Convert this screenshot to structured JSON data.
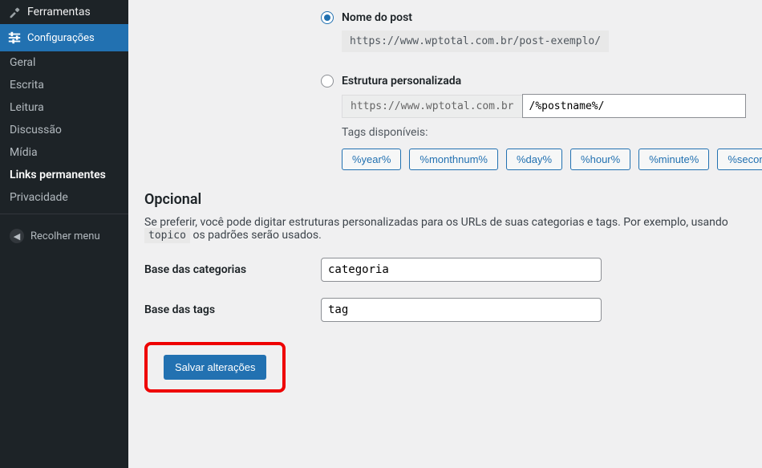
{
  "sidebar": {
    "tools_label": "Ferramentas",
    "settings_label": "Configurações",
    "items": [
      {
        "label": "Geral"
      },
      {
        "label": "Escrita"
      },
      {
        "label": "Leitura"
      },
      {
        "label": "Discussão"
      },
      {
        "label": "Mídia"
      },
      {
        "label": "Links permanentes"
      },
      {
        "label": "Privacidade"
      }
    ],
    "collapse_label": "Recolher menu"
  },
  "permalinks": {
    "post_name": {
      "label": "Nome do post",
      "url": "https://www.wptotal.com.br/post-exemplo/"
    },
    "custom": {
      "label": "Estrutura personalizada",
      "prefix": "https://www.wptotal.com.br",
      "value": "/%postname%/",
      "available_label": "Tags disponíveis:",
      "tags": [
        "%year%",
        "%monthnum%",
        "%day%",
        "%hour%",
        "%minute%",
        "%second%"
      ]
    }
  },
  "optional": {
    "heading": "Opcional",
    "desc_before": "Se preferir, você pode digitar estruturas personalizadas para os URLs de suas categorias e tags. Por exemplo, usando ",
    "desc_code": "topico",
    "desc_after": " os padrões serão usados.",
    "category_base_label": "Base das categorias",
    "category_base_value": "categoria",
    "tag_base_label": "Base das tags",
    "tag_base_value": "tag"
  },
  "save_label": "Salvar alterações"
}
